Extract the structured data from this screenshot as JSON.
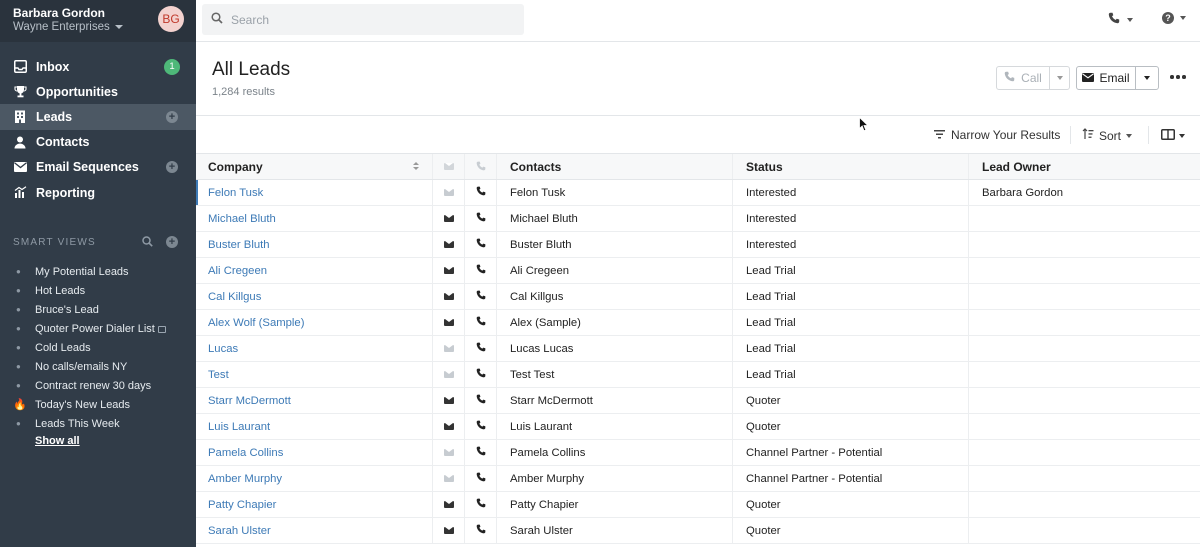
{
  "account": {
    "name": "Barbara Gordon",
    "org": "Wayne Enterprises",
    "avatar_initials": "BG"
  },
  "nav": [
    {
      "label": "Inbox",
      "icon": "inbox-icon",
      "badge": "1"
    },
    {
      "label": "Opportunities",
      "icon": "trophy-icon"
    },
    {
      "label": "Leads",
      "icon": "building-icon",
      "active": true
    },
    {
      "label": "Contacts",
      "icon": "person-icon"
    },
    {
      "label": "Email Sequences",
      "icon": "envelope-icon"
    },
    {
      "label": "Reporting",
      "icon": "chart-icon"
    }
  ],
  "smart_views": {
    "heading": "SMART VIEWS",
    "items": [
      "My Potential Leads",
      "Hot Leads",
      "Bruce's Lead",
      "Quoter Power Dialer List",
      "Cold Leads",
      "No calls/emails NY",
      "Contract renew 30 days",
      "Today's New Leads",
      "Leads This Week"
    ],
    "show_all": "Show all"
  },
  "search": {
    "placeholder": "Search"
  },
  "page": {
    "title": "All Leads",
    "results": "1,284 results"
  },
  "actions": {
    "call": "Call",
    "email": "Email"
  },
  "toolbar": {
    "narrow": "Narrow Your Results",
    "sort": "Sort"
  },
  "table": {
    "headers": {
      "company": "Company",
      "contacts": "Contacts",
      "status": "Status",
      "owner": "Lead Owner"
    },
    "rows": [
      {
        "company": "Felon Tusk",
        "email": false,
        "contact": "Felon Tusk",
        "status": "Interested",
        "owner": "Barbara Gordon"
      },
      {
        "company": "Michael Bluth",
        "email": true,
        "contact": "Michael Bluth",
        "status": "Interested",
        "owner": ""
      },
      {
        "company": "Buster Bluth",
        "email": true,
        "contact": "Buster Bluth",
        "status": "Interested",
        "owner": ""
      },
      {
        "company": "Ali Cregeen",
        "email": true,
        "contact": "Ali Cregeen",
        "status": "Lead Trial",
        "owner": ""
      },
      {
        "company": "Cal Killgus",
        "email": true,
        "contact": "Cal Killgus",
        "status": "Lead Trial",
        "owner": ""
      },
      {
        "company": "Alex Wolf (Sample)",
        "email": true,
        "contact": "Alex (Sample)",
        "status": "Lead Trial",
        "owner": ""
      },
      {
        "company": "Lucas",
        "email": false,
        "contact": "Lucas Lucas",
        "status": "Lead Trial",
        "owner": ""
      },
      {
        "company": "Test",
        "email": false,
        "contact": "Test Test",
        "status": "Lead Trial",
        "owner": ""
      },
      {
        "company": "Starr McDermott",
        "email": true,
        "contact": "Starr McDermott",
        "status": "Quoter",
        "owner": ""
      },
      {
        "company": "Luis Laurant",
        "email": true,
        "contact": "Luis Laurant",
        "status": "Quoter",
        "owner": ""
      },
      {
        "company": "Pamela Collins",
        "email": false,
        "contact": "Pamela Collins",
        "status": "Channel Partner - Potential",
        "owner": ""
      },
      {
        "company": "Amber Murphy",
        "email": false,
        "contact": "Amber Murphy",
        "status": "Channel Partner - Potential",
        "owner": ""
      },
      {
        "company": "Patty Chapier",
        "email": true,
        "contact": "Patty Chapier",
        "status": "Quoter",
        "owner": ""
      },
      {
        "company": "Sarah Ulster",
        "email": true,
        "contact": "Sarah Ulster",
        "status": "Quoter",
        "owner": ""
      }
    ]
  }
}
